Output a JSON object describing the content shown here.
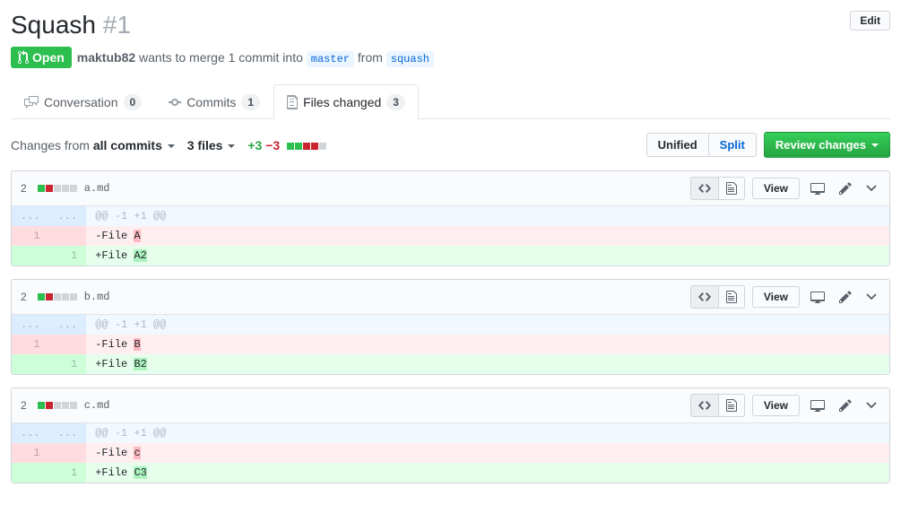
{
  "title": "Squash",
  "issue_number": "#1",
  "edit_label": "Edit",
  "state": "Open",
  "author": "maktub82",
  "merge_text_1": " wants to merge 1 commit into ",
  "base_branch": "master",
  "merge_text_2": " from ",
  "head_branch": "squash",
  "tabs": {
    "conversation": {
      "label": "Conversation",
      "count": "0"
    },
    "commits": {
      "label": "Commits",
      "count": "1"
    },
    "files": {
      "label": "Files changed",
      "count": "3"
    }
  },
  "toolbar": {
    "changes_from_prefix": "Changes from ",
    "changes_from_value": "all commits",
    "files_count": "3 files",
    "additions": "+3",
    "deletions": "−3",
    "unified": "Unified",
    "split": "Split",
    "review": "Review changes"
  },
  "file_actions": {
    "view": "View"
  },
  "files": [
    {
      "changes": "2",
      "name": "a.md",
      "hunk": "@@ -1 +1 @@",
      "del_num": "1",
      "del_prefix": "-File ",
      "del_hl": "A",
      "del_suffix": "",
      "add_num": "1",
      "add_prefix": "+File ",
      "add_hl": "A2",
      "add_suffix": ""
    },
    {
      "changes": "2",
      "name": "b.md",
      "hunk": "@@ -1 +1 @@",
      "del_num": "1",
      "del_prefix": "-File ",
      "del_hl": "B",
      "del_suffix": "",
      "add_num": "1",
      "add_prefix": "+File ",
      "add_hl": "B2",
      "add_suffix": ""
    },
    {
      "changes": "2",
      "name": "c.md",
      "hunk": "@@ -1 +1 @@",
      "del_num": "1",
      "del_prefix": "-File ",
      "del_hl": "c",
      "del_suffix": "",
      "add_num": "1",
      "add_prefix": "+File ",
      "add_hl": "C3",
      "add_suffix": ""
    }
  ]
}
